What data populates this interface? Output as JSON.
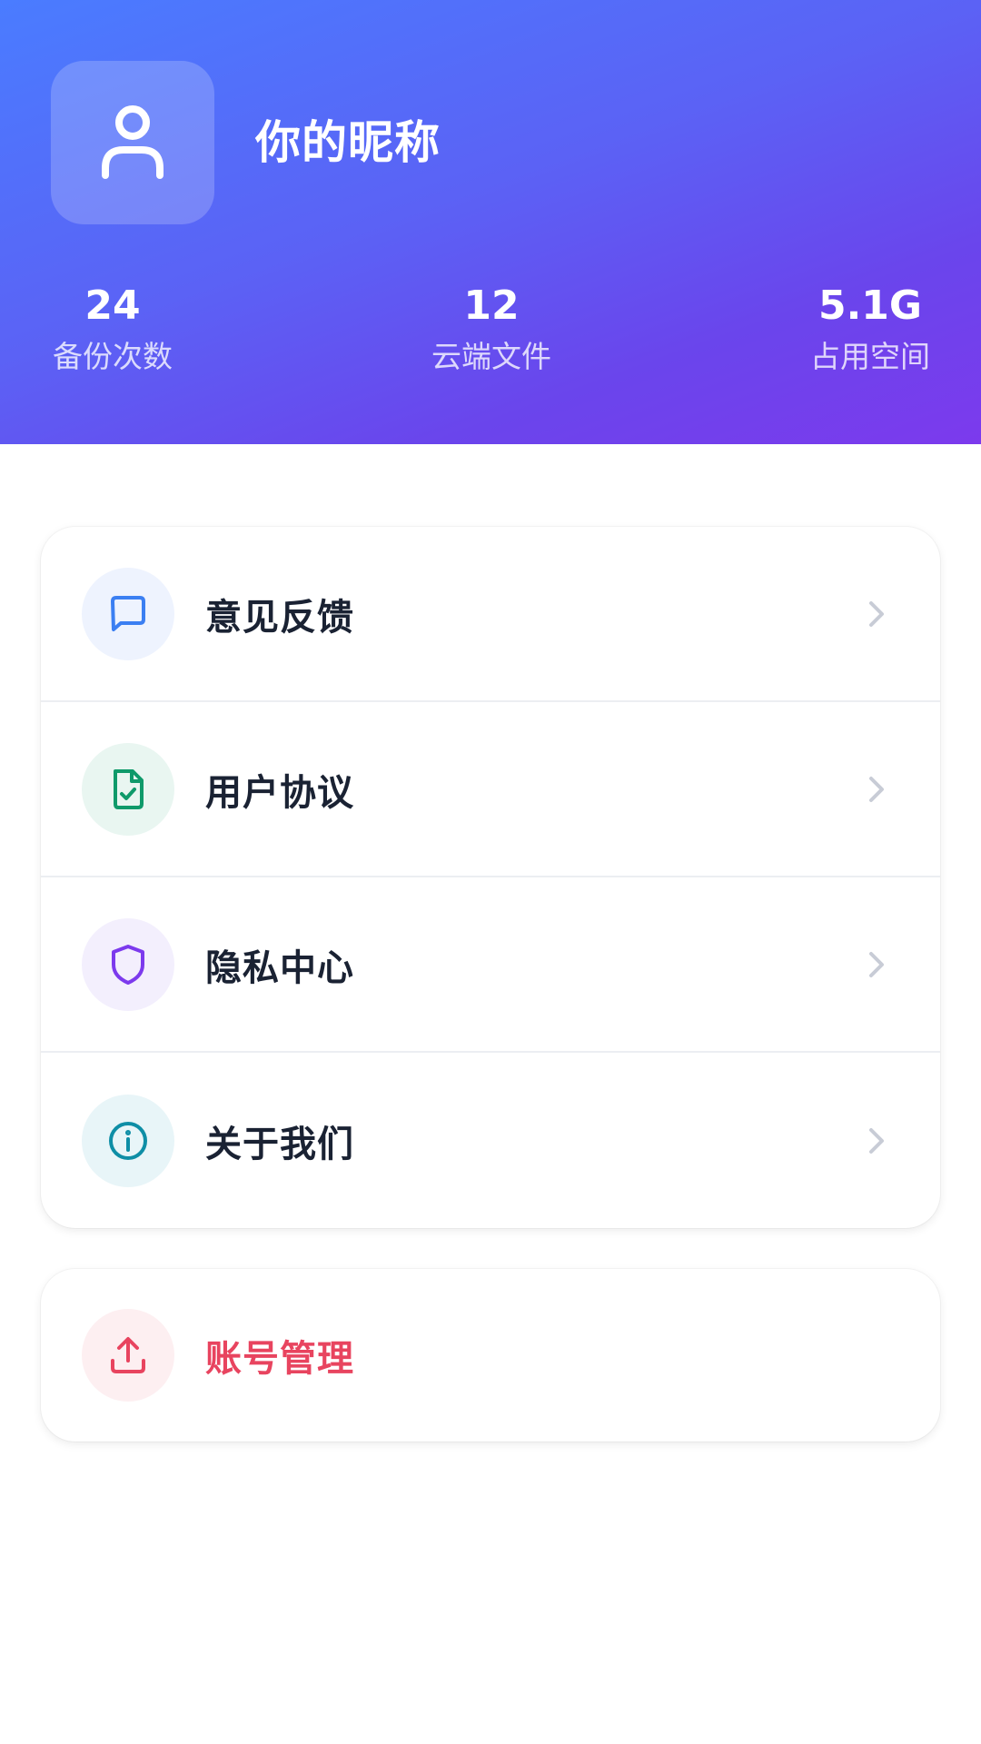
{
  "profile": {
    "nickname": "你的昵称",
    "avatar_icon": "user-icon"
  },
  "stats": [
    {
      "value": "24",
      "label": "备份次数"
    },
    {
      "value": "12",
      "label": "云端文件"
    },
    {
      "value": "5.1G",
      "label": "占用空间"
    }
  ],
  "menu": [
    {
      "label": "意见反馈",
      "icon": "message-icon",
      "color": "#3b7ff2",
      "bg": "#eef3fe"
    },
    {
      "label": "用户协议",
      "icon": "document-check-icon",
      "color": "#0f9a6a",
      "bg": "#e9f6f1"
    },
    {
      "label": "隐私中心",
      "icon": "shield-icon",
      "color": "#7c3aed",
      "bg": "#f3effd"
    },
    {
      "label": "关于我们",
      "icon": "info-icon",
      "color": "#0e8ea6",
      "bg": "#e8f5f8"
    }
  ],
  "account": {
    "label": "账号管理",
    "icon": "upload-icon",
    "color": "#e8445f",
    "bg": "#fdeff1"
  },
  "colors": {
    "header_gradient_start": "#4a7cff",
    "header_gradient_end": "#7c3aed",
    "chevron": "#c8ccd6"
  }
}
